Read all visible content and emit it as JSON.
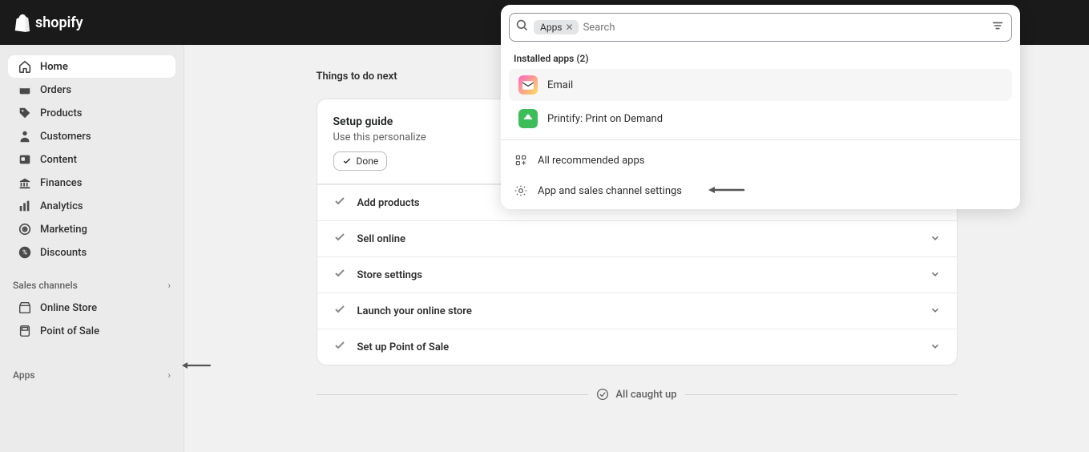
{
  "brand": "shopify",
  "sidebar": {
    "items": [
      {
        "label": "Home",
        "icon": "home"
      },
      {
        "label": "Orders",
        "icon": "orders"
      },
      {
        "label": "Products",
        "icon": "products"
      },
      {
        "label": "Customers",
        "icon": "customers"
      },
      {
        "label": "Content",
        "icon": "content"
      },
      {
        "label": "Finances",
        "icon": "finances"
      },
      {
        "label": "Analytics",
        "icon": "analytics"
      },
      {
        "label": "Marketing",
        "icon": "marketing"
      },
      {
        "label": "Discounts",
        "icon": "discounts"
      }
    ],
    "channels_label": "Sales channels",
    "channels": [
      {
        "label": "Online Store"
      },
      {
        "label": "Point of Sale"
      }
    ],
    "apps_label": "Apps"
  },
  "main": {
    "heading": "Things to do next",
    "setup_guide": {
      "title": "Setup guide",
      "subtitle": "Use this personalize",
      "done_label": "Done"
    },
    "tasks": [
      {
        "label": "Add products"
      },
      {
        "label": "Sell online"
      },
      {
        "label": "Store settings"
      },
      {
        "label": "Launch your online store"
      },
      {
        "label": "Set up Point of Sale"
      }
    ],
    "caught_up": "All caught up"
  },
  "search": {
    "chip": "Apps",
    "placeholder": "Search",
    "installed_label": "Installed apps (2)",
    "apps": [
      {
        "name": "Email",
        "icon": "email"
      },
      {
        "name": "Printify: Print on Demand",
        "icon": "printify"
      }
    ],
    "links": [
      {
        "label": "All recommended apps",
        "icon": "grid"
      },
      {
        "label": "App and sales channel settings",
        "icon": "gear"
      }
    ]
  }
}
